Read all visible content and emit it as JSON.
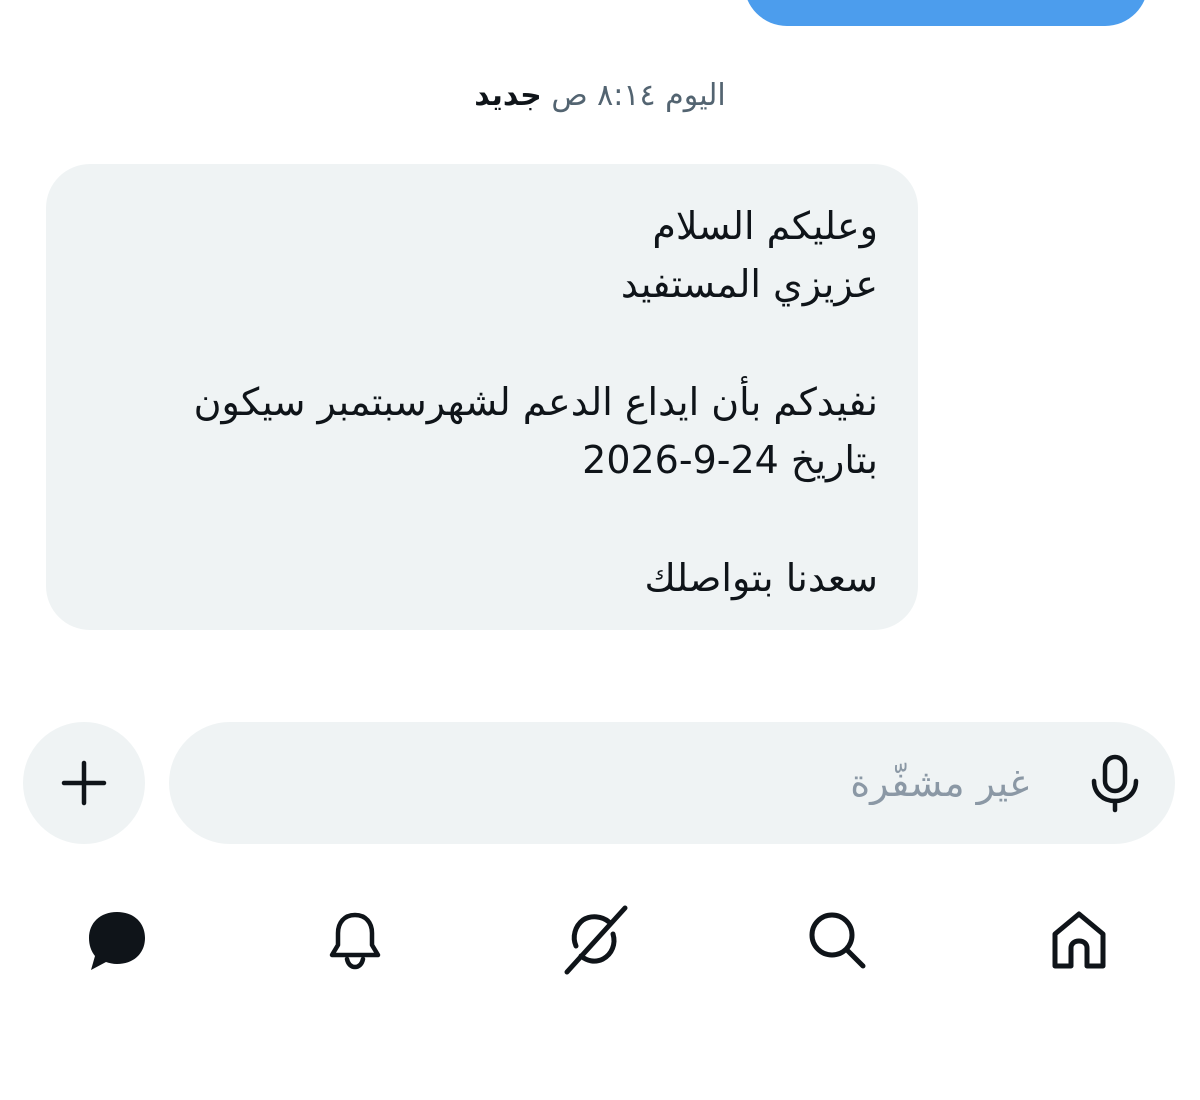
{
  "conversation": {
    "timestamp": {
      "day": "اليوم",
      "time": "٨:١٤ ص",
      "new_label": "جديد"
    },
    "received_message": {
      "lines": [
        "وعليكم السلام",
        "عزيزي المستفيد",
        "نفيدكم بأن ايداع الدعم لشهرسبتمبر سيكون",
        "بتاريخ 24-9-2026",
        "سعدنا بتواصلك"
      ]
    }
  },
  "composer": {
    "placeholder": "غير مشفّرة",
    "icons": {
      "add": "plus-icon",
      "voice": "microphone-icon"
    }
  },
  "bottom_nav": {
    "items": [
      "messages-icon",
      "notifications-icon",
      "grok-icon",
      "search-icon",
      "home-icon"
    ]
  },
  "colors": {
    "sent_bubble": "#4c9ded",
    "received_bubble": "#eff3f4",
    "text": "#0f1419",
    "muted_text": "#536471",
    "placeholder": "#8b98a5"
  }
}
